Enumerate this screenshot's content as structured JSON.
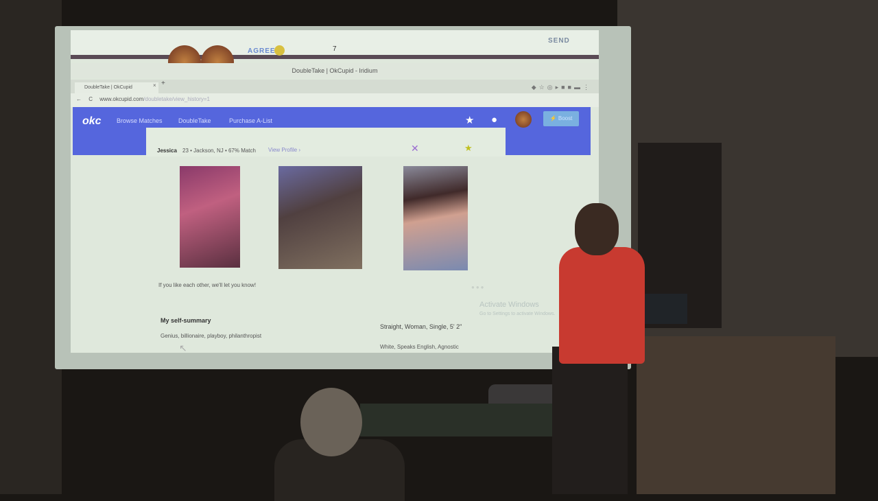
{
  "chat": {
    "agree_label": "AGREE",
    "count": "7",
    "send_label": "SEND"
  },
  "browser": {
    "window_title": "DoubleTake | OkCupid - Iridium",
    "tab_title": "DoubleTake | OkCupid",
    "tab_close": "×",
    "new_tab": "+",
    "url_host": "www.okcupid.com",
    "url_path": "/doubletake/view_history=1"
  },
  "okc": {
    "logo": "okc",
    "nav": [
      "Browse Matches",
      "DoubleTake",
      "Purchase A-List"
    ],
    "boost_label": "⚡ Boost"
  },
  "profile": {
    "name": "Jessica",
    "meta": "23 • Jackson, NJ • 67% Match",
    "view_profile": "View Profile ›",
    "note": "If you like each other, we'll let you know!",
    "self_summary_heading": "My self-summary",
    "self_summary": "Genius, billionaire, playboy, philanthropist",
    "details": [
      "Straight, Woman, Single, 5' 2\"",
      "White, Speaks English, Agnostic"
    ]
  },
  "watermark": {
    "title": "Activate Windows",
    "subtitle": "Go to Settings to activate Windows."
  }
}
